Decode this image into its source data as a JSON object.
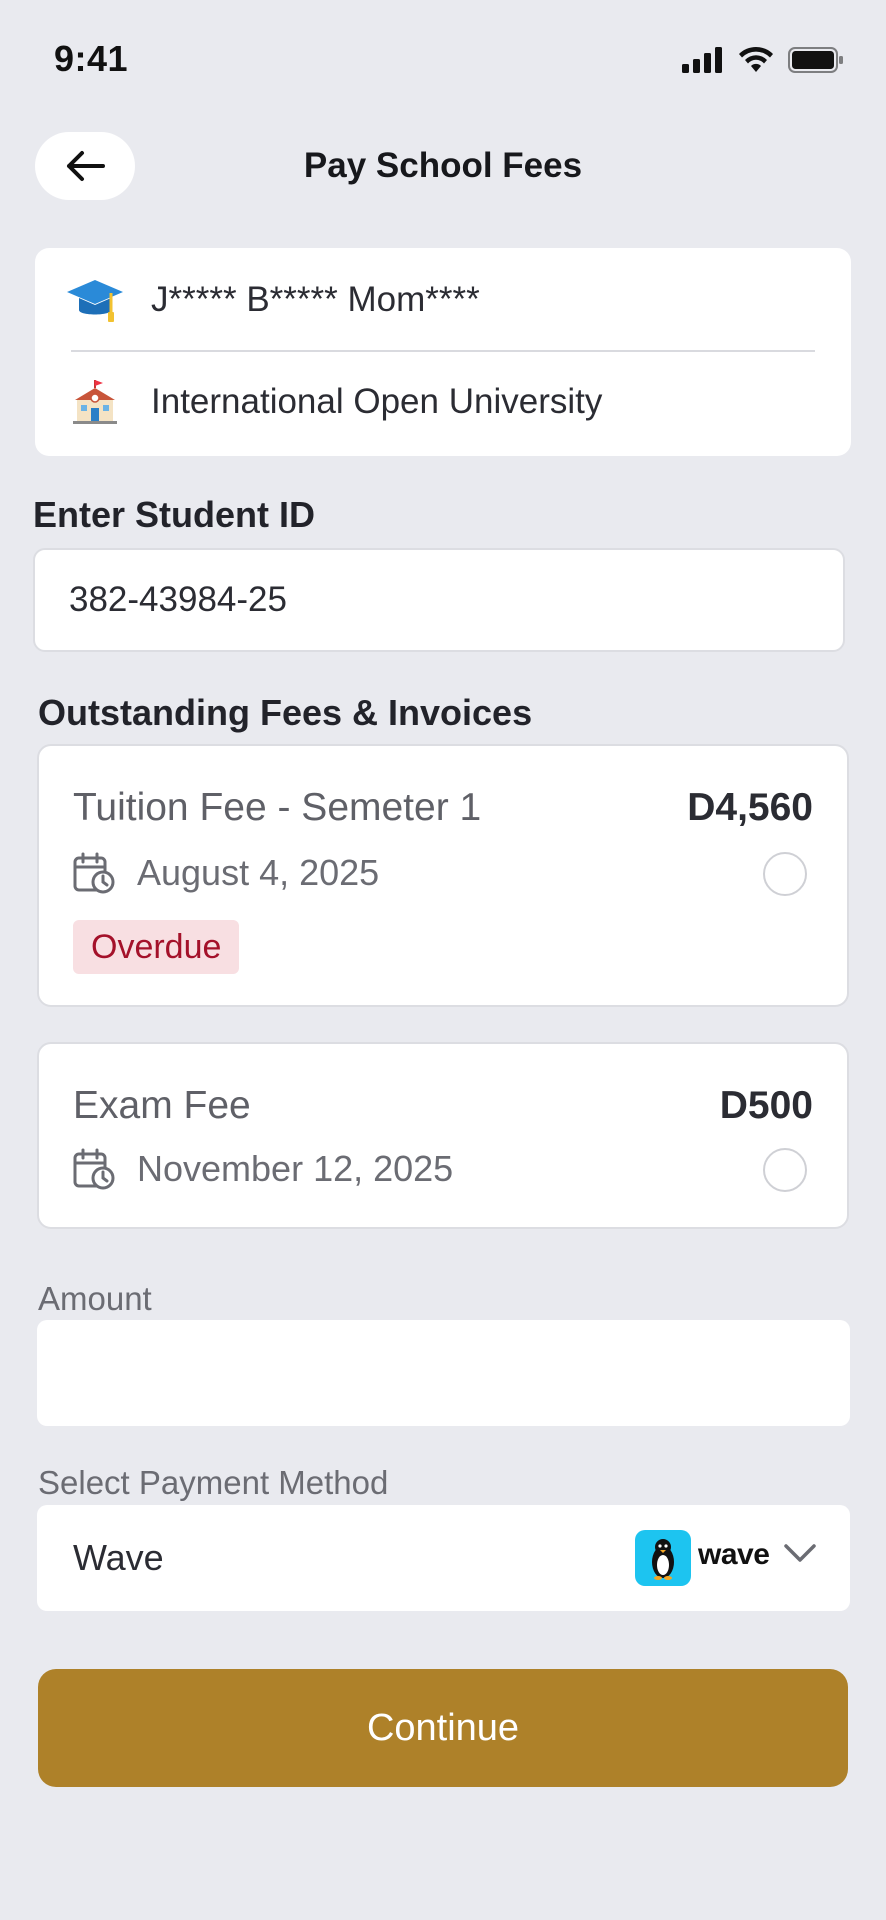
{
  "status_bar": {
    "time": "9:41"
  },
  "header": {
    "title": "Pay School Fees"
  },
  "student": {
    "name": "J***** B***** Mom****",
    "school": "International Open University"
  },
  "student_id": {
    "label": "Enter Student ID",
    "value": "382-43984-25"
  },
  "fees": {
    "label": "Outstanding Fees & Invoices",
    "items": [
      {
        "title": "Tuition Fee - Semeter 1",
        "amount": "D4,560",
        "date": "August 4, 2025",
        "badge": "Overdue"
      },
      {
        "title": "Exam Fee",
        "amount": "D500",
        "date": "November 12, 2025"
      }
    ]
  },
  "amount": {
    "label": "Amount",
    "value": ""
  },
  "payment_method": {
    "label": "Select Payment Method",
    "selected": "Wave",
    "brand_text": "wave",
    "brand_color": "#1dc4f0"
  },
  "continue_label": "Continue",
  "colors": {
    "accent": "#ae8129",
    "background": "#e9eaef",
    "overdue_bg": "#f8dfe2",
    "overdue_text": "#a4112a"
  }
}
